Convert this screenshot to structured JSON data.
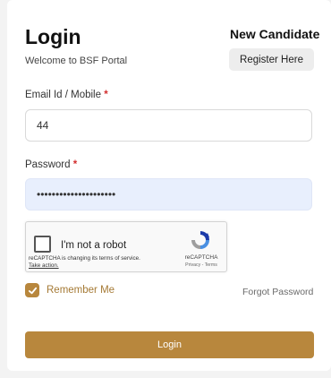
{
  "header": {
    "title": "Login",
    "subtitle": "Welcome to BSF Portal",
    "new_candidate": "New Candidate",
    "register_label": "Register Here"
  },
  "form": {
    "email": {
      "label": "Email Id / Mobile",
      "required_mark": "*",
      "value": "44"
    },
    "password": {
      "label": "Password",
      "required_mark": "*",
      "masked_value": "•••••••••••••••••••••"
    }
  },
  "captcha": {
    "checkbox_label": "I'm not a robot",
    "notice": "reCAPTCHA is changing its terms of service.",
    "notice_link": "Take action.",
    "brand": "reCAPTCHA",
    "links": "Privacy - Terms",
    "logo_icon": "recaptcha-logo-icon"
  },
  "options": {
    "remember_label": "Remember Me",
    "remember_checked": true,
    "forgot_label": "Forgot Password"
  },
  "actions": {
    "login_label": "Login"
  },
  "colors": {
    "accent": "#b8873d",
    "required": "#d32f2f",
    "password_bg": "#e8effd"
  }
}
